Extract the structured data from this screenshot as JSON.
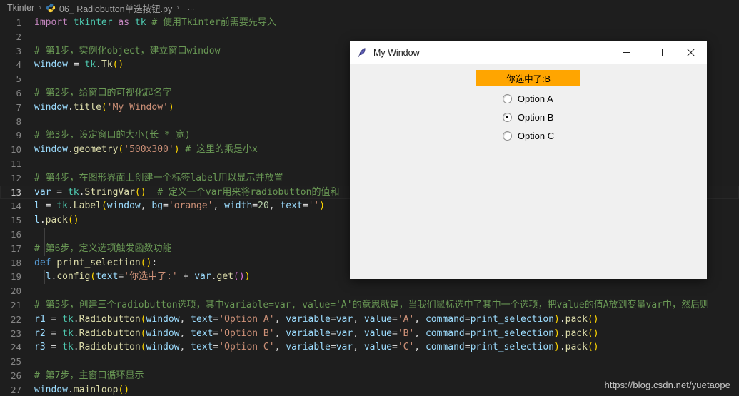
{
  "breadcrumb": {
    "root": "Tkinter",
    "file_icon": "python-file-icon",
    "file": "06_ Radiobutton单选按钮.py",
    "more": "...",
    "separator": "›"
  },
  "editor": {
    "active_line": 13,
    "lines": [
      {
        "n": "1",
        "tokens": [
          {
            "t": "import",
            "c": "kw"
          },
          {
            "t": " ",
            "c": "op"
          },
          {
            "t": "tkinter",
            "c": "mod"
          },
          {
            "t": " ",
            "c": "op"
          },
          {
            "t": "as",
            "c": "kw"
          },
          {
            "t": " ",
            "c": "op"
          },
          {
            "t": "tk",
            "c": "mod"
          },
          {
            "t": " ",
            "c": "op"
          },
          {
            "t": "# 使用Tkinter前需要先导入",
            "c": "cmt"
          }
        ]
      },
      {
        "n": "2",
        "tokens": []
      },
      {
        "n": "3",
        "tokens": [
          {
            "t": "# 第1步，实例化object，建立窗口window",
            "c": "cmt"
          }
        ]
      },
      {
        "n": "4",
        "tokens": [
          {
            "t": "window",
            "c": "var"
          },
          {
            "t": " = ",
            "c": "op"
          },
          {
            "t": "tk",
            "c": "mod"
          },
          {
            "t": ".",
            "c": "punct"
          },
          {
            "t": "Tk",
            "c": "fn"
          },
          {
            "t": "(",
            "c": "paren1"
          },
          {
            "t": ")",
            "c": "paren1"
          }
        ]
      },
      {
        "n": "5",
        "tokens": []
      },
      {
        "n": "6",
        "tokens": [
          {
            "t": "# 第2步，给窗口的可视化起名字",
            "c": "cmt"
          }
        ]
      },
      {
        "n": "7",
        "tokens": [
          {
            "t": "window",
            "c": "var"
          },
          {
            "t": ".",
            "c": "punct"
          },
          {
            "t": "title",
            "c": "fn"
          },
          {
            "t": "(",
            "c": "paren1"
          },
          {
            "t": "'My Window'",
            "c": "str"
          },
          {
            "t": ")",
            "c": "paren1"
          }
        ]
      },
      {
        "n": "8",
        "tokens": []
      },
      {
        "n": "9",
        "tokens": [
          {
            "t": "# 第3步，设定窗口的大小(长 * 宽)",
            "c": "cmt"
          }
        ]
      },
      {
        "n": "10",
        "tokens": [
          {
            "t": "window",
            "c": "var"
          },
          {
            "t": ".",
            "c": "punct"
          },
          {
            "t": "geometry",
            "c": "fn"
          },
          {
            "t": "(",
            "c": "paren1"
          },
          {
            "t": "'500x300'",
            "c": "str"
          },
          {
            "t": ")",
            "c": "paren1"
          },
          {
            "t": " ",
            "c": "op"
          },
          {
            "t": "# 这里的乘是小x",
            "c": "cmt"
          }
        ]
      },
      {
        "n": "11",
        "tokens": []
      },
      {
        "n": "12",
        "tokens": [
          {
            "t": "# 第4步，在图形界面上创建一个标签label用以显示并放置",
            "c": "cmt"
          }
        ]
      },
      {
        "n": "13",
        "tokens": [
          {
            "t": "var",
            "c": "var"
          },
          {
            "t": " = ",
            "c": "op"
          },
          {
            "t": "tk",
            "c": "mod"
          },
          {
            "t": ".",
            "c": "punct"
          },
          {
            "t": "StringVar",
            "c": "fn"
          },
          {
            "t": "(",
            "c": "paren1"
          },
          {
            "t": ")",
            "c": "paren1"
          },
          {
            "t": "  ",
            "c": "op"
          },
          {
            "t": "# 定义一个var用来将radiobutton的值和",
            "c": "cmt"
          }
        ]
      },
      {
        "n": "14",
        "tokens": [
          {
            "t": "l",
            "c": "var"
          },
          {
            "t": " = ",
            "c": "op"
          },
          {
            "t": "tk",
            "c": "mod"
          },
          {
            "t": ".",
            "c": "punct"
          },
          {
            "t": "Label",
            "c": "fn"
          },
          {
            "t": "(",
            "c": "paren1"
          },
          {
            "t": "window",
            "c": "var"
          },
          {
            "t": ", ",
            "c": "punct"
          },
          {
            "t": "bg",
            "c": "var"
          },
          {
            "t": "=",
            "c": "op"
          },
          {
            "t": "'orange'",
            "c": "str"
          },
          {
            "t": ", ",
            "c": "punct"
          },
          {
            "t": "width",
            "c": "var"
          },
          {
            "t": "=",
            "c": "op"
          },
          {
            "t": "20",
            "c": "num"
          },
          {
            "t": ", ",
            "c": "punct"
          },
          {
            "t": "text",
            "c": "var"
          },
          {
            "t": "=",
            "c": "op"
          },
          {
            "t": "''",
            "c": "str"
          },
          {
            "t": ")",
            "c": "paren1"
          }
        ]
      },
      {
        "n": "15",
        "tokens": [
          {
            "t": "l",
            "c": "var"
          },
          {
            "t": ".",
            "c": "punct"
          },
          {
            "t": "pack",
            "c": "fn"
          },
          {
            "t": "(",
            "c": "paren1"
          },
          {
            "t": ")",
            "c": "paren1"
          }
        ]
      },
      {
        "n": "16",
        "tokens": [],
        "guide": true
      },
      {
        "n": "17",
        "tokens": [
          {
            "t": "# 第6步，定义选项触发函数功能",
            "c": "cmt"
          }
        ],
        "guide": true,
        "indent": 1
      },
      {
        "n": "18",
        "tokens": [
          {
            "t": "def",
            "c": "kw2"
          },
          {
            "t": " ",
            "c": "op"
          },
          {
            "t": "print_selection",
            "c": "fn"
          },
          {
            "t": "(",
            "c": "paren1"
          },
          {
            "t": ")",
            "c": "paren1"
          },
          {
            "t": ":",
            "c": "punct"
          }
        ]
      },
      {
        "n": "19",
        "tokens": [
          {
            "t": "  ",
            "c": "op"
          },
          {
            "t": "l",
            "c": "var"
          },
          {
            "t": ".",
            "c": "punct"
          },
          {
            "t": "config",
            "c": "fn"
          },
          {
            "t": "(",
            "c": "paren1"
          },
          {
            "t": "text",
            "c": "var"
          },
          {
            "t": "=",
            "c": "op"
          },
          {
            "t": "'你选中了:'",
            "c": "str"
          },
          {
            "t": " + ",
            "c": "op"
          },
          {
            "t": "var",
            "c": "var"
          },
          {
            "t": ".",
            "c": "punct"
          },
          {
            "t": "get",
            "c": "fn"
          },
          {
            "t": "(",
            "c": "paren2"
          },
          {
            "t": ")",
            "c": "paren2"
          },
          {
            "t": ")",
            "c": "paren1"
          }
        ],
        "guide": true
      },
      {
        "n": "20",
        "tokens": []
      },
      {
        "n": "21",
        "tokens": [
          {
            "t": "# 第5步，创建三个radiobutton选项，其中variable=var, value='A'的意思就是，当我们鼠标选中了其中一个选项，把value的值A放到变量var中，然后则",
            "c": "cmt"
          }
        ]
      },
      {
        "n": "22",
        "tokens": [
          {
            "t": "r1",
            "c": "var"
          },
          {
            "t": " = ",
            "c": "op"
          },
          {
            "t": "tk",
            "c": "mod"
          },
          {
            "t": ".",
            "c": "punct"
          },
          {
            "t": "Radiobutton",
            "c": "fn"
          },
          {
            "t": "(",
            "c": "paren1"
          },
          {
            "t": "window",
            "c": "var"
          },
          {
            "t": ", ",
            "c": "punct"
          },
          {
            "t": "text",
            "c": "var"
          },
          {
            "t": "=",
            "c": "op"
          },
          {
            "t": "'Option A'",
            "c": "str"
          },
          {
            "t": ", ",
            "c": "punct"
          },
          {
            "t": "variable",
            "c": "var"
          },
          {
            "t": "=",
            "c": "op"
          },
          {
            "t": "var",
            "c": "var"
          },
          {
            "t": ", ",
            "c": "punct"
          },
          {
            "t": "value",
            "c": "var"
          },
          {
            "t": "=",
            "c": "op"
          },
          {
            "t": "'A'",
            "c": "str"
          },
          {
            "t": ", ",
            "c": "punct"
          },
          {
            "t": "command",
            "c": "var"
          },
          {
            "t": "=",
            "c": "op"
          },
          {
            "t": "print_selection",
            "c": "var"
          },
          {
            "t": ")",
            "c": "paren1"
          },
          {
            "t": ".",
            "c": "punct"
          },
          {
            "t": "pack",
            "c": "fn"
          },
          {
            "t": "(",
            "c": "paren1"
          },
          {
            "t": ")",
            "c": "paren1"
          }
        ]
      },
      {
        "n": "23",
        "tokens": [
          {
            "t": "r2",
            "c": "var"
          },
          {
            "t": " = ",
            "c": "op"
          },
          {
            "t": "tk",
            "c": "mod"
          },
          {
            "t": ".",
            "c": "punct"
          },
          {
            "t": "Radiobutton",
            "c": "fn"
          },
          {
            "t": "(",
            "c": "paren1"
          },
          {
            "t": "window",
            "c": "var"
          },
          {
            "t": ", ",
            "c": "punct"
          },
          {
            "t": "text",
            "c": "var"
          },
          {
            "t": "=",
            "c": "op"
          },
          {
            "t": "'Option B'",
            "c": "str"
          },
          {
            "t": ", ",
            "c": "punct"
          },
          {
            "t": "variable",
            "c": "var"
          },
          {
            "t": "=",
            "c": "op"
          },
          {
            "t": "var",
            "c": "var"
          },
          {
            "t": ", ",
            "c": "punct"
          },
          {
            "t": "value",
            "c": "var"
          },
          {
            "t": "=",
            "c": "op"
          },
          {
            "t": "'B'",
            "c": "str"
          },
          {
            "t": ", ",
            "c": "punct"
          },
          {
            "t": "command",
            "c": "var"
          },
          {
            "t": "=",
            "c": "op"
          },
          {
            "t": "print_selection",
            "c": "var"
          },
          {
            "t": ")",
            "c": "paren1"
          },
          {
            "t": ".",
            "c": "punct"
          },
          {
            "t": "pack",
            "c": "fn"
          },
          {
            "t": "(",
            "c": "paren1"
          },
          {
            "t": ")",
            "c": "paren1"
          }
        ]
      },
      {
        "n": "24",
        "tokens": [
          {
            "t": "r3",
            "c": "var"
          },
          {
            "t": " = ",
            "c": "op"
          },
          {
            "t": "tk",
            "c": "mod"
          },
          {
            "t": ".",
            "c": "punct"
          },
          {
            "t": "Radiobutton",
            "c": "fn"
          },
          {
            "t": "(",
            "c": "paren1"
          },
          {
            "t": "window",
            "c": "var"
          },
          {
            "t": ", ",
            "c": "punct"
          },
          {
            "t": "text",
            "c": "var"
          },
          {
            "t": "=",
            "c": "op"
          },
          {
            "t": "'Option C'",
            "c": "str"
          },
          {
            "t": ", ",
            "c": "punct"
          },
          {
            "t": "variable",
            "c": "var"
          },
          {
            "t": "=",
            "c": "op"
          },
          {
            "t": "var",
            "c": "var"
          },
          {
            "t": ", ",
            "c": "punct"
          },
          {
            "t": "value",
            "c": "var"
          },
          {
            "t": "=",
            "c": "op"
          },
          {
            "t": "'C'",
            "c": "str"
          },
          {
            "t": ", ",
            "c": "punct"
          },
          {
            "t": "command",
            "c": "var"
          },
          {
            "t": "=",
            "c": "op"
          },
          {
            "t": "print_selection",
            "c": "var"
          },
          {
            "t": ")",
            "c": "paren1"
          },
          {
            "t": ".",
            "c": "punct"
          },
          {
            "t": "pack",
            "c": "fn"
          },
          {
            "t": "(",
            "c": "paren1"
          },
          {
            "t": ")",
            "c": "paren1"
          }
        ]
      },
      {
        "n": "25",
        "tokens": []
      },
      {
        "n": "26",
        "tokens": [
          {
            "t": "# 第7步，主窗口循环显示",
            "c": "cmt"
          }
        ]
      },
      {
        "n": "27",
        "tokens": [
          {
            "t": "window",
            "c": "var"
          },
          {
            "t": ".",
            "c": "punct"
          },
          {
            "t": "mainloop",
            "c": "fn"
          },
          {
            "t": "(",
            "c": "paren1"
          },
          {
            "t": ")",
            "c": "paren1"
          }
        ]
      }
    ]
  },
  "tk_window": {
    "title": "My Window",
    "icon": "tkinter-feather-icon",
    "minimize_label": "—",
    "maximize_label": "☐",
    "close_label": "✕",
    "label_text": "你选中了:B",
    "label_bg": "#ffa500",
    "radios": [
      {
        "label": "Option A",
        "selected": false
      },
      {
        "label": "Option B",
        "selected": true
      },
      {
        "label": "Option C",
        "selected": false
      }
    ]
  },
  "watermark": {
    "text": "https://blog.csdn.net/yuetaope"
  }
}
